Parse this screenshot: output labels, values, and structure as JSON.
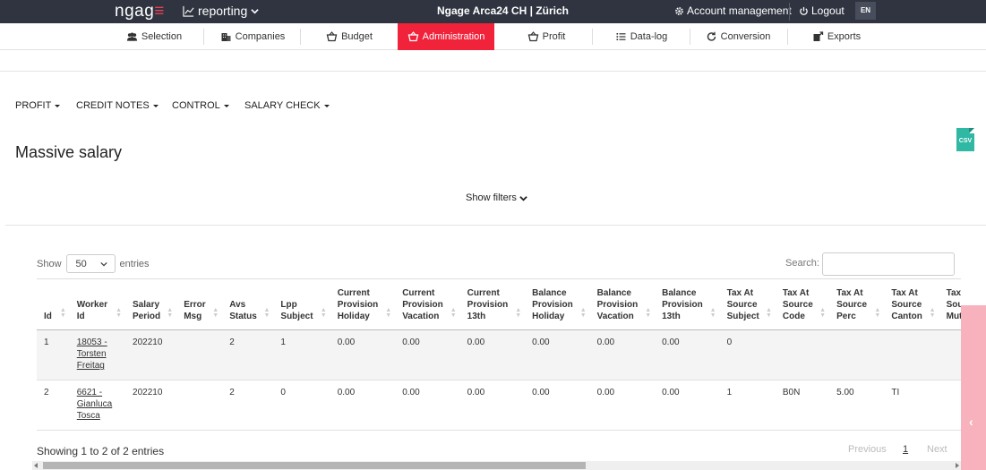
{
  "topbar": {
    "brand_main": "ngag",
    "brand_accent": "≡",
    "app_menu": "reporting",
    "title": "Ngage Arca24 CH | Zürich",
    "account": "Account management",
    "logout": "Logout",
    "lang": "EN"
  },
  "nav": {
    "items": [
      {
        "label": "Selection",
        "icon": "users-icon"
      },
      {
        "label": "Companies",
        "icon": "building-icon"
      },
      {
        "label": "Budget",
        "icon": "basket-icon"
      },
      {
        "label": "Administration",
        "icon": "basket-icon"
      },
      {
        "label": "Profit",
        "icon": "basket-icon"
      },
      {
        "label": "Data-log",
        "icon": "list-icon"
      },
      {
        "label": "Conversion",
        "icon": "refresh-icon"
      },
      {
        "label": "Exports",
        "icon": "export-icon"
      }
    ],
    "active": "Administration"
  },
  "submenu": [
    "PROFIT",
    "CREDIT NOTES",
    "CONTROL",
    "SALARY CHECK"
  ],
  "page": {
    "title": "Massive salary",
    "csv_label": "CSV",
    "show_filters": "Show filters"
  },
  "datatable": {
    "show_label": "Show",
    "entries_label": "entries",
    "page_length": "50",
    "search_label": "Search:",
    "columns": [
      [
        "Id"
      ],
      [
        "Worker",
        "Id"
      ],
      [
        "Salary",
        "Period"
      ],
      [
        "Error",
        "Msg"
      ],
      [
        "Avs",
        "Status"
      ],
      [
        "Lpp",
        "Subject"
      ],
      [
        "Current",
        "Provision",
        "Holiday"
      ],
      [
        "Current",
        "Provision",
        "Vacation"
      ],
      [
        "Current",
        "Provision",
        "13th"
      ],
      [
        "Balance",
        "Provision",
        "Holiday"
      ],
      [
        "Balance",
        "Provision",
        "Vacation"
      ],
      [
        "Balance",
        "Provision",
        "13th"
      ],
      [
        "Tax At",
        "Source",
        "Subject"
      ],
      [
        "Tax At",
        "Source",
        "Code"
      ],
      [
        "Tax At",
        "Source",
        "Perc"
      ],
      [
        "Tax At",
        "Source",
        "Canton"
      ],
      [
        "Tax At",
        "Souce",
        "Mutation"
      ]
    ],
    "rows": [
      {
        "id": "1",
        "worker": "18053 - Torsten Freitag",
        "period": "202210",
        "error": "",
        "avs": "2",
        "lpp": "1",
        "cph": "0.00",
        "cpv": "0.00",
        "cp13": "0.00",
        "bph": "0.00",
        "bpv": "0.00",
        "bp13": "0.00",
        "tass": "0",
        "tasc": "",
        "tasp": "",
        "tascan": "",
        "tasm": ""
      },
      {
        "id": "2",
        "worker": "6621 - Gianluca Tosca",
        "period": "202210",
        "error": "",
        "avs": "2",
        "lpp": "0",
        "cph": "0.00",
        "cpv": "0.00",
        "cp13": "0.00",
        "bph": "0.00",
        "bpv": "0.00",
        "bp13": "0.00",
        "tass": "1",
        "tasc": "B0N",
        "tasp": "5.00",
        "tascan": "TI",
        "tasm": ""
      }
    ],
    "info": "Showing 1 to 2 of 2 entries",
    "pagination": {
      "previous": "Previous",
      "current": "1",
      "next": "Next"
    }
  },
  "colors": {
    "topbar": "#2f3440",
    "accent": "#f0233b",
    "csv": "#2fb8a4",
    "side_tab": "#f7b2bd"
  }
}
